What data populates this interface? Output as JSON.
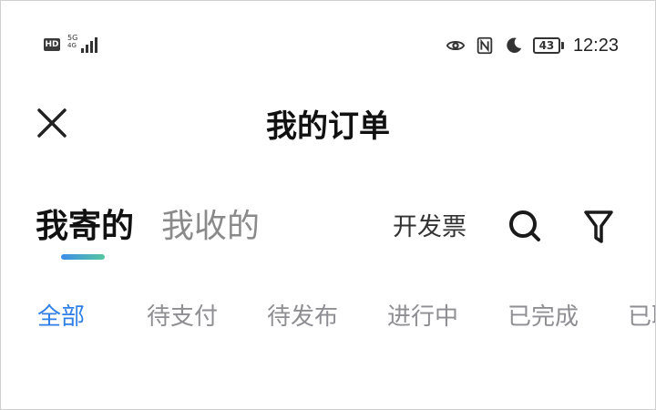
{
  "status_bar": {
    "hd_badge": "HD",
    "network_line1": "5G",
    "network_line2": "4G",
    "battery_level": "43",
    "time": "12:23",
    "icons": [
      "signal-icon",
      "eye-icon",
      "nfc-icon",
      "moon-icon",
      "battery-icon"
    ]
  },
  "header": {
    "title": "我的订单",
    "close_icon": "close-icon"
  },
  "main_tabs": [
    {
      "label": "我寄的",
      "active": true
    },
    {
      "label": "我收的",
      "active": false
    }
  ],
  "toolbar": {
    "invoice_label": "开发票",
    "search_icon": "search-icon",
    "filter_icon": "filter-icon"
  },
  "status_tabs": [
    {
      "label": "全部",
      "active": true
    },
    {
      "label": "待支付",
      "active": false
    },
    {
      "label": "待发布",
      "active": false
    },
    {
      "label": "进行中",
      "active": false
    },
    {
      "label": "已完成",
      "active": false
    },
    {
      "label": "已取消",
      "active": false
    }
  ],
  "colors": {
    "accent_blue": "#2f7fe6",
    "indicator_gradient_start": "#3e8de8",
    "indicator_gradient_end": "#56c7a0",
    "inactive_text": "#8e8e93"
  }
}
